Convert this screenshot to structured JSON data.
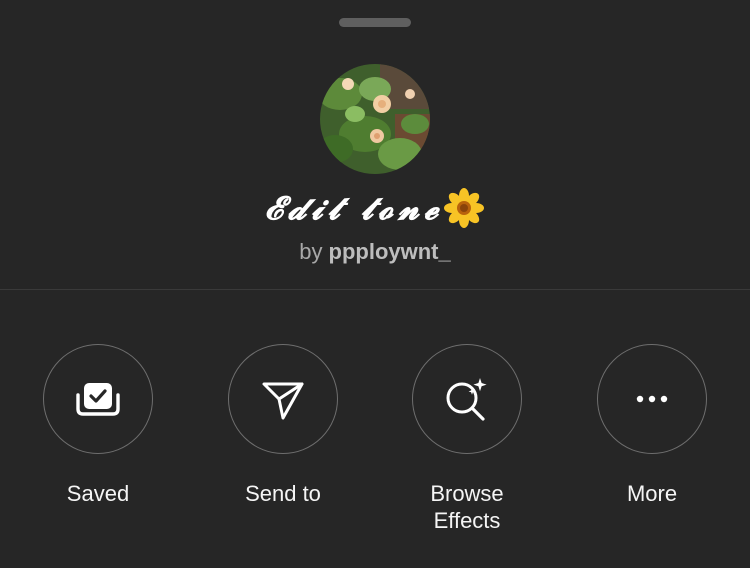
{
  "effect": {
    "title": "𝓔𝓭𝓲𝓽 𝓽𝓸𝓷𝓮",
    "creator_prefix": "by",
    "creator": "ppploywnt_"
  },
  "icons": {
    "avatar": "flower-photo-thumbnail",
    "title_emoji": "sunflower-icon",
    "saved": "saved-collection-icon",
    "send": "paper-plane-icon",
    "browse": "search-sparkle-icon",
    "more": "ellipsis-icon"
  },
  "actions": [
    {
      "label": "Saved"
    },
    {
      "label": "Send to"
    },
    {
      "label": "Browse\nEffects"
    },
    {
      "label": "More"
    }
  ],
  "colors": {
    "background": "#262626",
    "divider": "#3a3a3a",
    "secondary_text": "#a8a8a8",
    "circle_border": "#6e6e6e"
  }
}
